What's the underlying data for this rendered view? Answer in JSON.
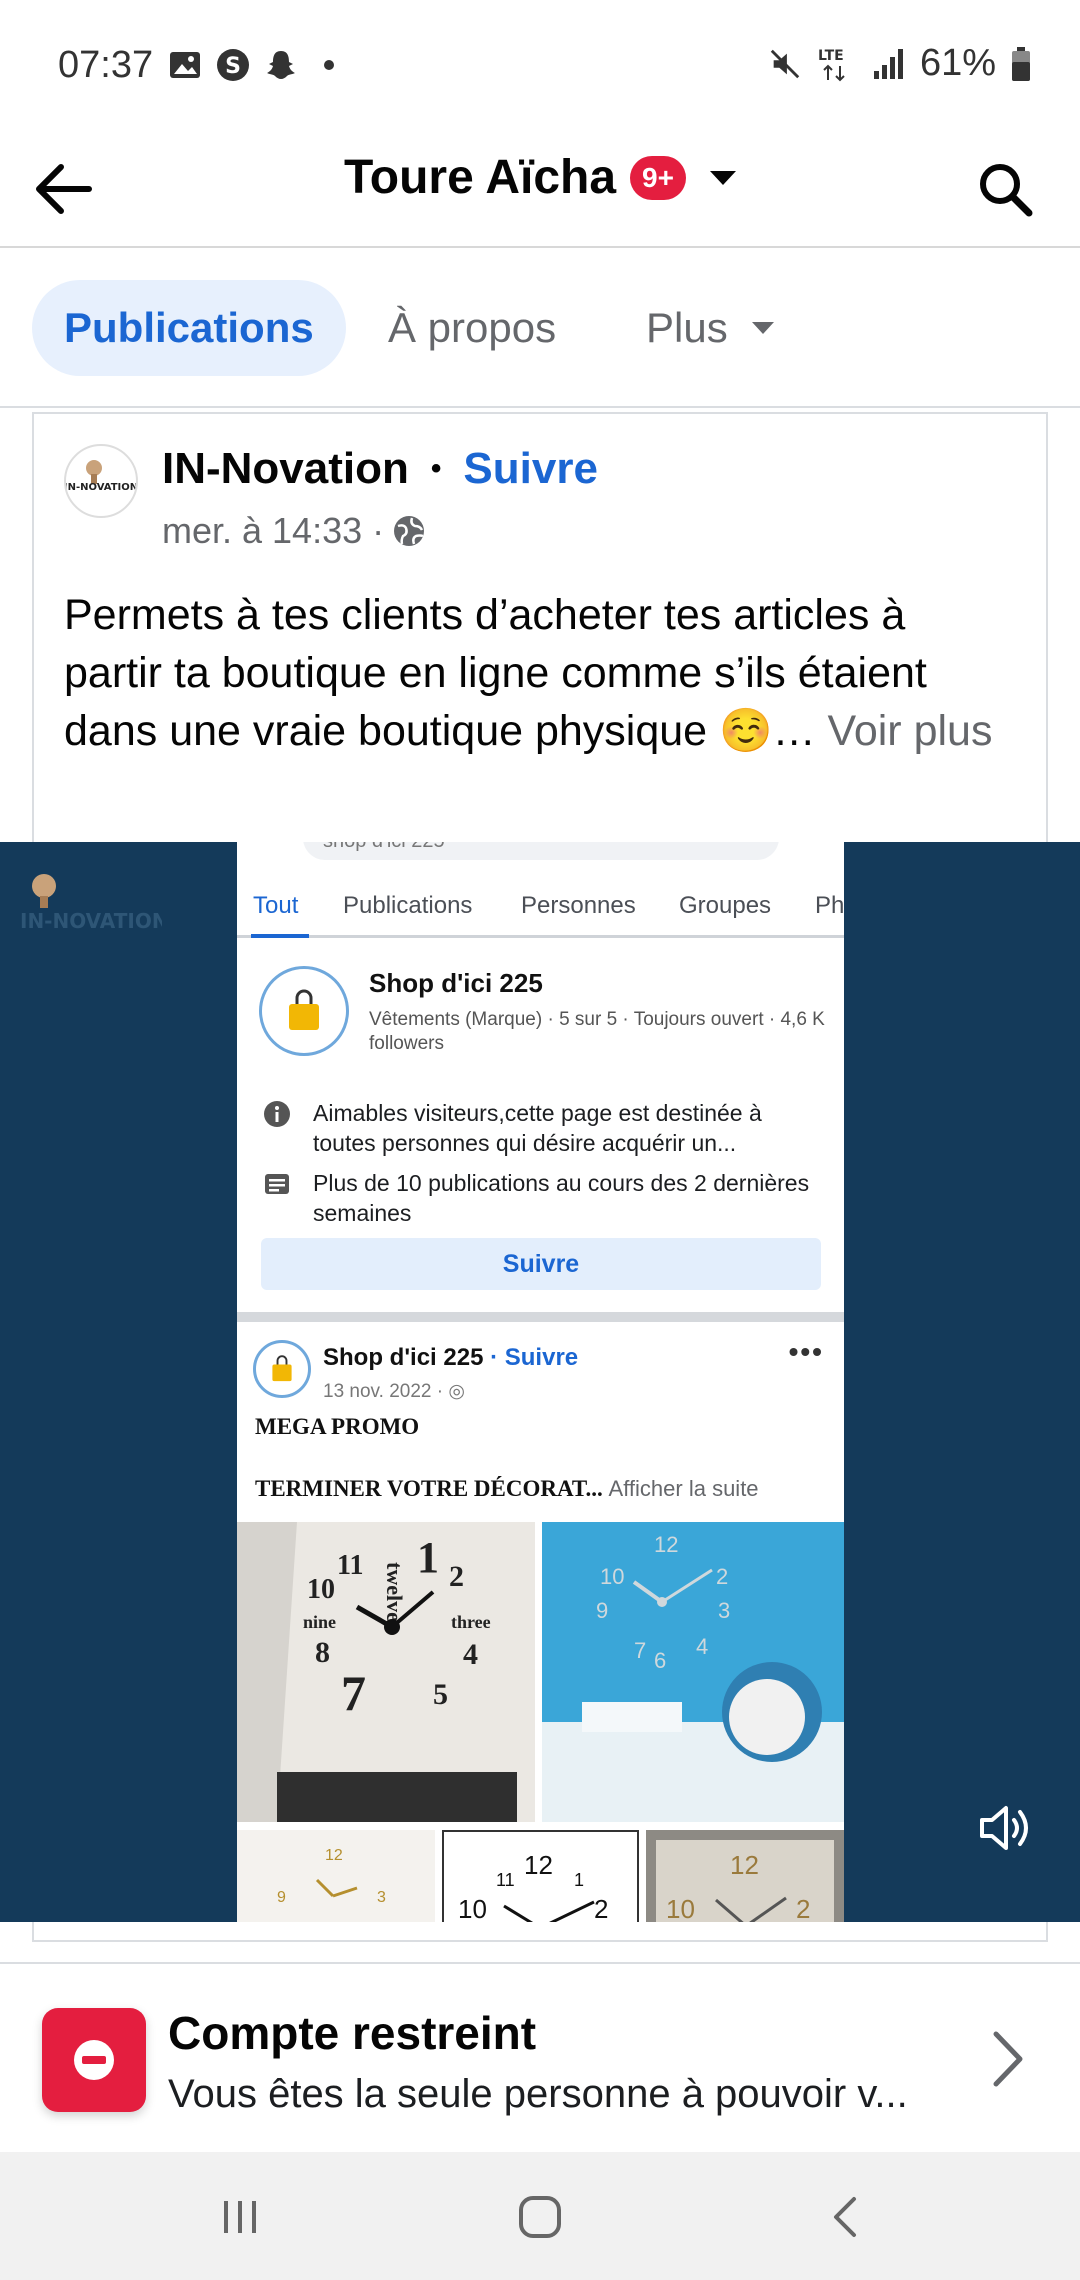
{
  "status_bar": {
    "time": "07:37",
    "network": "LTE",
    "battery": "61%",
    "icons": [
      "gallery-icon",
      "s-app-icon",
      "snapchat-icon",
      "dot-icon",
      "mute-icon",
      "lte-icon",
      "signal-icon",
      "battery-icon"
    ]
  },
  "header": {
    "title": "Toure Aïcha",
    "badge": "9+",
    "badge_color": "#e41e3f"
  },
  "tabs": [
    {
      "label": "Publications"
    },
    {
      "label": "À propos"
    },
    {
      "label": "Plus"
    }
  ],
  "post": {
    "author": "IN-Novation",
    "separator": "•",
    "follow": "Suivre",
    "time": "mer. à 14:33 ·",
    "text": "Permets à tes clients d’acheter tes articles à partir ta boutique en ligne comme s’ils étaient dans une vraie boutique physique ☺️…",
    "see_more": "Voir plus"
  },
  "media": {
    "background_color": "#143a5a",
    "search_text": "shop d'ici 225",
    "tabs": [
      "Tout",
      "Publications",
      "Personnes",
      "Groupes",
      "Ph"
    ],
    "page_name": "Shop d'ici 225",
    "page_info": "Vêtements (Marque) · 5 sur 5 · Toujours ouvert · 4,6 K followers",
    "info_row_1": "Aimables visiteurs,cette page est destinée à toutes personnes qui désire acquérir un...",
    "info_row_2": "Plus de 10 publications au cours des 2 dernières semaines",
    "follow_button": "Suivre",
    "post_author": "Shop d'ici 225",
    "post_follow": "· Suivre",
    "post_date": "13 nov. 2022 ·",
    "promo_title": "MEGA PROMO",
    "promo_text": "TERMINER VOTRE DÉCORAT...",
    "read_more": "Afficher la suite",
    "clock_labels": [
      "11",
      "1",
      "2",
      "10",
      "nine",
      "three",
      "8",
      "4",
      "7",
      "5",
      "twelve"
    ]
  },
  "restricted": {
    "title": "Compte restreint",
    "subtitle": "Vous êtes la seule personne à pouvoir v..."
  },
  "accent_color": "#1b66d2"
}
